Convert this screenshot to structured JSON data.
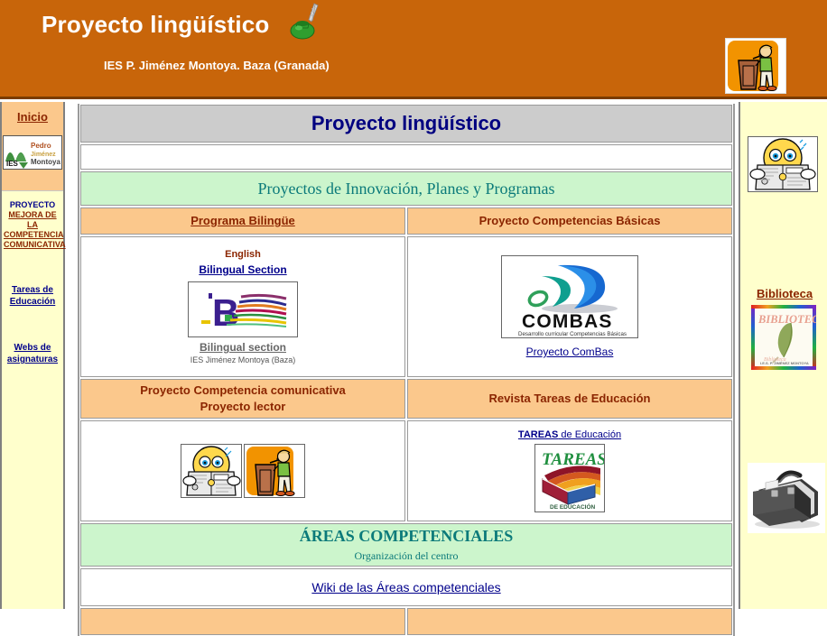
{
  "header": {
    "title": "Proyecto lingüístico",
    "subtitle": "IES P. Jiménez Montoya. Baza (Granada)",
    "bg_color": "#c8650a",
    "inkwell_icon": "inkwell-quill-icon",
    "podium_icon": "podium-speaker-image"
  },
  "left_sidebar": {
    "inicio": "Inicio",
    "logo_alt": "IES Pedro Jiménez Montoya",
    "logo_text_ies": "IES",
    "logo_text_line1": "Pedro",
    "logo_text_line2": "Jiménez",
    "logo_text_line3": "Montoya",
    "proyecto_line1": "PROYECTO",
    "proyecto_line2": "MEJORA DE LA",
    "proyecto_line3": "COMPETENCIA",
    "proyecto_line4": "COMUNICATIVA",
    "tareas_line1": "Tareas de",
    "tareas_line2": "Educación",
    "webs_line1": "Webs de",
    "webs_line2": "asignaturas"
  },
  "main": {
    "page_title": "Proyecto lingüístico",
    "section_innovacion": "Proyectos de Innovación, Planes y Programas",
    "col_bilingue_header": "Programa Bilingüe",
    "col_combas_header": "Proyecto Competencias Básicas",
    "bilingue": {
      "english_label": "English",
      "bilingual_section_link": "Bilingual Section",
      "logo_letter": "B",
      "caption_link": "Bilingual section",
      "caption_sub": "IES Jiménez Montoya (Baza)"
    },
    "combas": {
      "logo_text": "COMBAS",
      "logo_tagline": "Desarrollo curricular Competencias Básicas",
      "caption_link": "Proyecto ComBas"
    },
    "col_comunicativa_header_line1": "Proyecto Competencia comunicativa",
    "col_comunicativa_header_line2": "Proyecto lector",
    "col_revista_header": "Revista Tareas de Educación",
    "revista": {
      "link_bold": "TAREAS",
      "link_rest": " de Educación",
      "logo_text": "TAREAS",
      "logo_sub": "DE EDUCACIÓN"
    },
    "section_areas_title": "ÁREAS COMPETENCIALES",
    "section_areas_sub": "Organización del centro",
    "wiki_link": "Wiki de las Áreas competenciales"
  },
  "right_sidebar": {
    "news_icon": "smiley-reading-newspaper-image",
    "biblioteca_label": "Biblioteca",
    "biblioteca_logo_text": "BIBLIOTECA",
    "briefcase_icon": "briefcase-image"
  },
  "colors": {
    "header_orange": "#c8650a",
    "sidebar_cream": "#ffffcc",
    "cell_orange": "#fbc88c",
    "cell_green": "#ccf5cc",
    "title_gray": "#cccccc",
    "link_navy": "#00008b",
    "heading_maroon": "#8b2500",
    "green_teal": "#0b7a7a"
  }
}
